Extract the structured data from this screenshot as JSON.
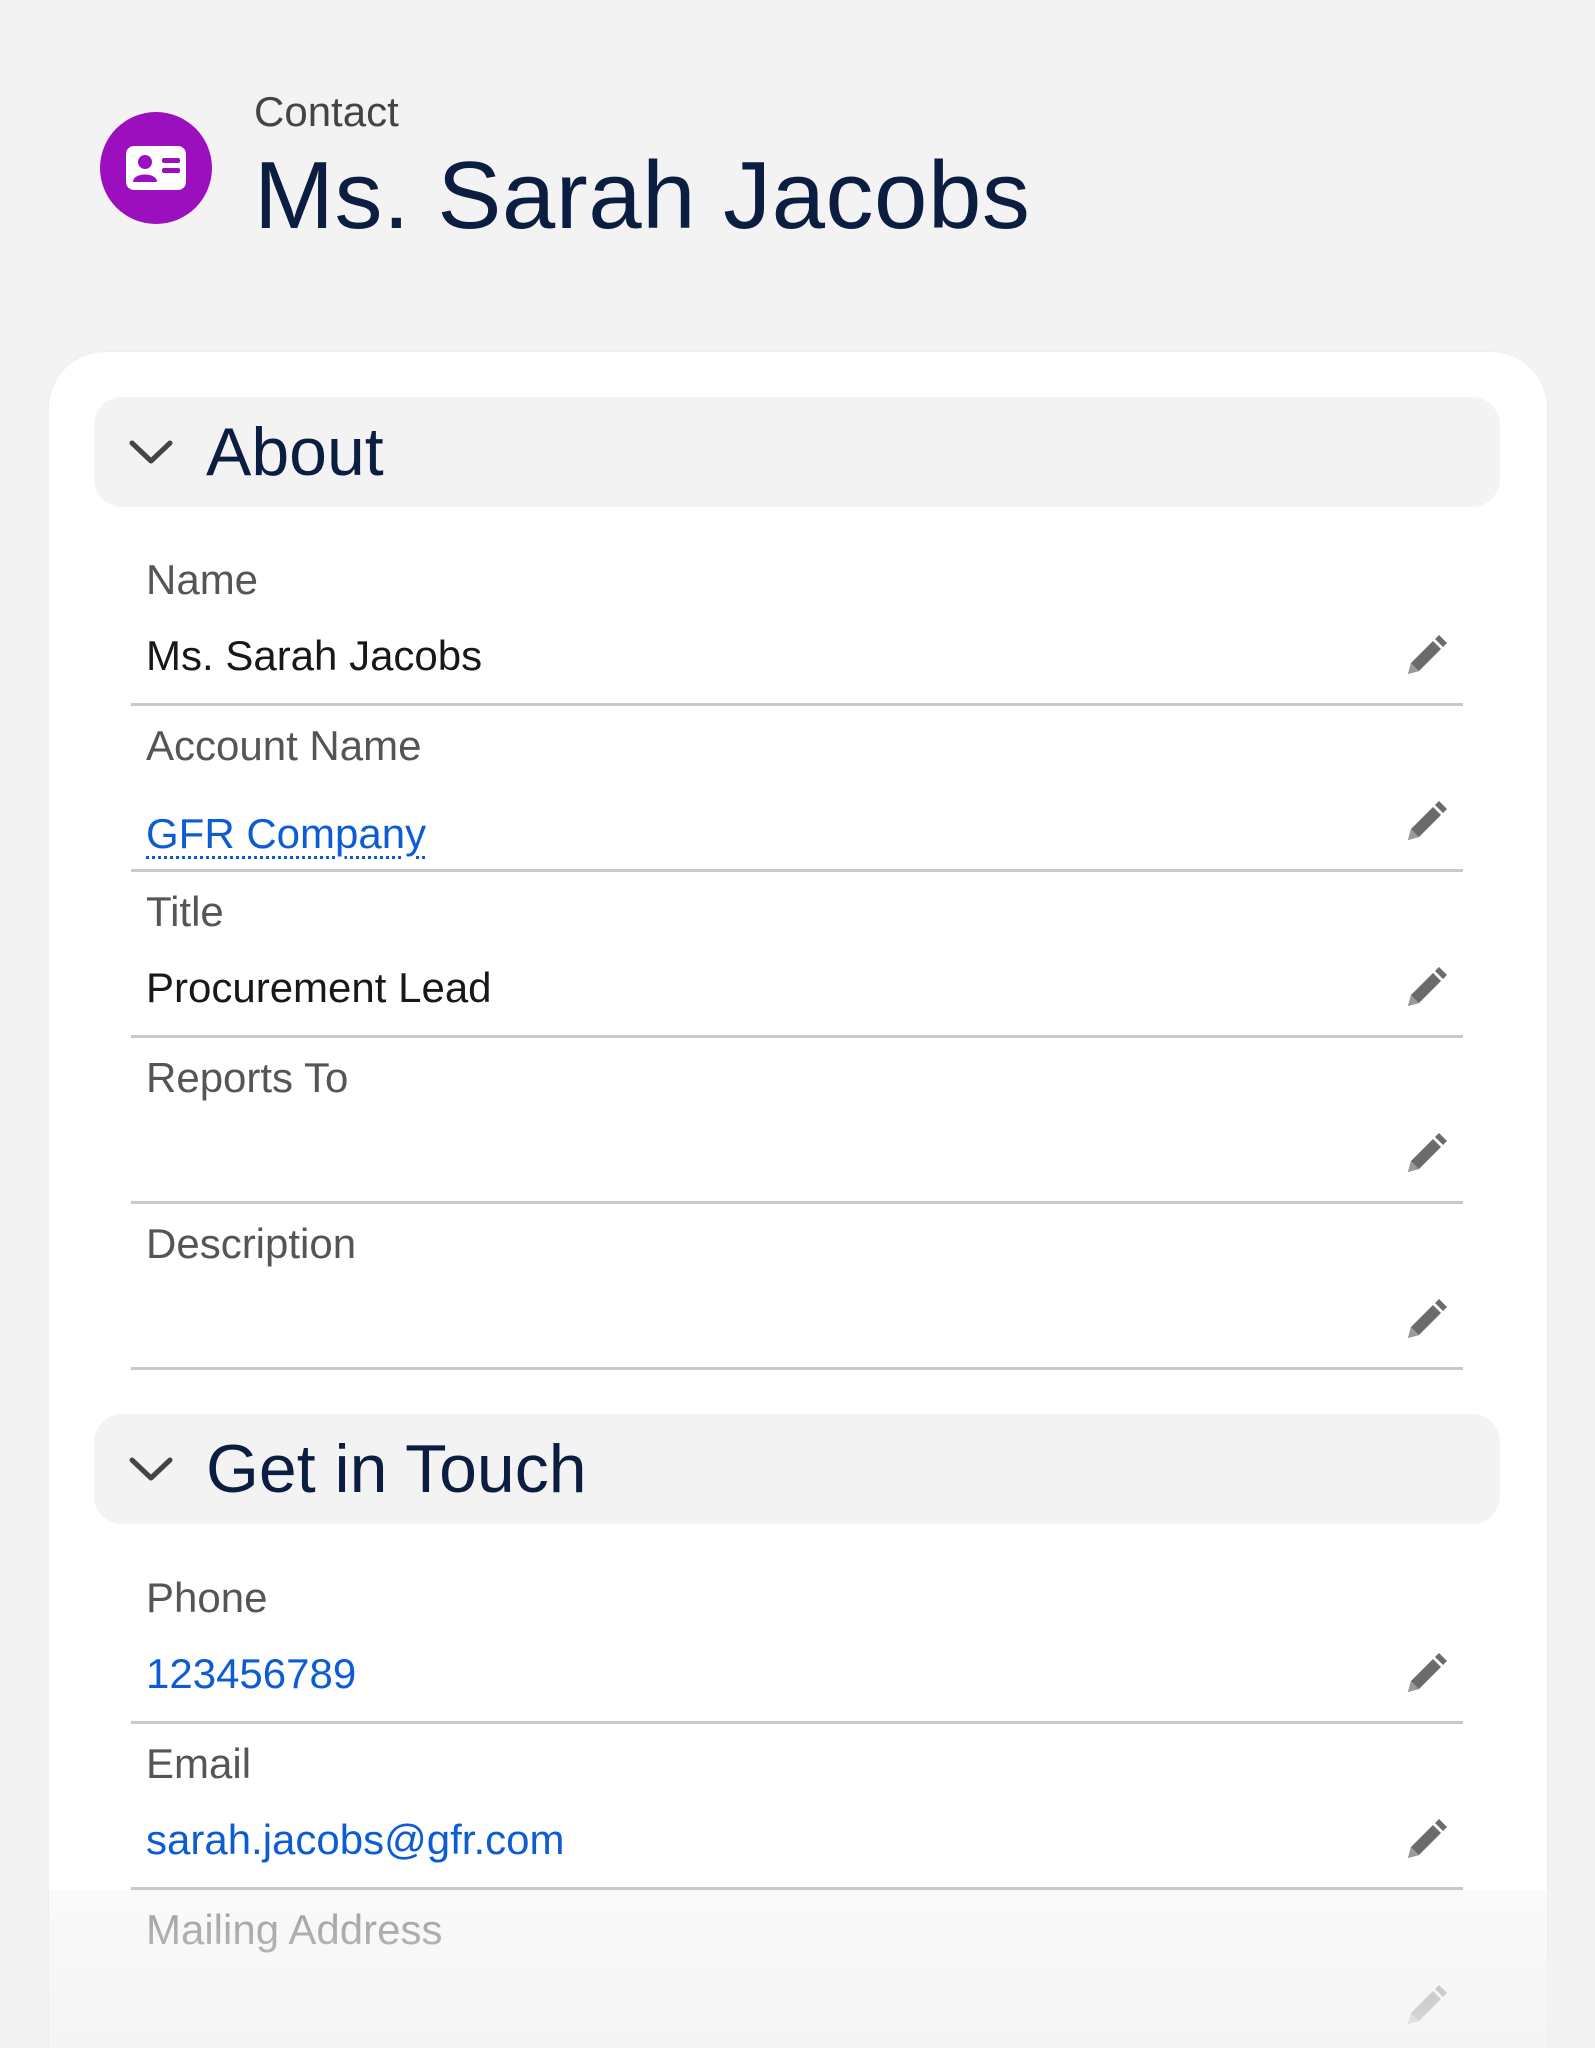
{
  "header": {
    "object_label": "Contact",
    "record_name": "Ms. Sarah Jacobs",
    "icon": "contact-card-icon",
    "icon_color": "#9c0fbe"
  },
  "sections": [
    {
      "title": "About",
      "fields": [
        {
          "label": "Name",
          "value": "Ms. Sarah Jacobs"
        },
        {
          "label": "Account Name",
          "value": "GFR Company"
        },
        {
          "label": "Title",
          "value": "Procurement Lead"
        },
        {
          "label": "Reports To",
          "value": ""
        },
        {
          "label": "Description",
          "value": ""
        }
      ]
    },
    {
      "title": "Get in Touch",
      "fields": [
        {
          "label": "Phone",
          "value": "123456789"
        },
        {
          "label": "Email",
          "value": "sarah.jacobs@gfr.com"
        },
        {
          "label": "Mailing Address",
          "value": ""
        }
      ]
    }
  ],
  "colors": {
    "link": "#0b5cd5",
    "heading": "#0b1d40",
    "section_bg": "#f3f3f3",
    "divider": "#c9c9c9"
  },
  "icons": {
    "chevron": "chevron-down-icon",
    "edit": "pencil-icon"
  }
}
